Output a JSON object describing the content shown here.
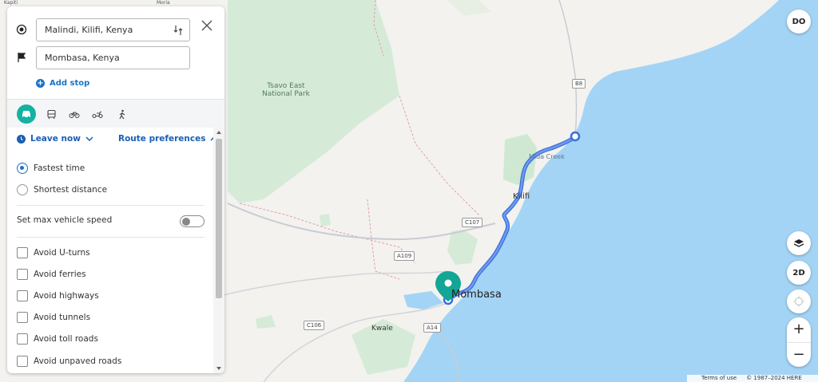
{
  "route": {
    "origin": "Malindi, Kilifi, Kenya",
    "destination": "Mombasa, Kenya",
    "add_stop": "Add stop"
  },
  "modes": [
    {
      "name": "car",
      "active": true
    },
    {
      "name": "public-transport",
      "active": false
    },
    {
      "name": "bicycle",
      "active": false
    },
    {
      "name": "scooter",
      "active": false
    },
    {
      "name": "pedestrian",
      "active": false
    }
  ],
  "options": {
    "leave_now": "Leave now",
    "route_preferences": "Route preferences",
    "fastest_time": "Fastest time",
    "shortest_distance": "Shortest distance",
    "selected": "fastest",
    "max_speed_label": "Set max vehicle speed",
    "max_speed_enabled": false,
    "avoid": [
      "Avoid U-turns",
      "Avoid ferries",
      "Avoid highways",
      "Avoid tunnels",
      "Avoid toll roads",
      "Avoid unpaved roads"
    ]
  },
  "map": {
    "labels": {
      "tsavo": "Tsavo East\nNational Park",
      "watamu": "Mida Creek",
      "kilifi": "Kilifi",
      "mombasa": "Mombasa",
      "kwale": "Kwale",
      "a109": "A109",
      "c107": "C107",
      "c106": "C106",
      "a14": "A14",
      "b8": "B8",
      "top1": "Kapiti",
      "top2": "Moria"
    },
    "controls": {
      "user_initials": "DO",
      "view_mode": "2D",
      "zoom_in": "+",
      "zoom_out": "−"
    },
    "footer": {
      "terms": "Terms of use",
      "copyright": "© 1987–2024 HERE"
    },
    "colors": {
      "water": "#a3d4f5",
      "land": "#f3f2ef",
      "park": "#cfe8d2",
      "route": "#4a7fe0",
      "marker": "#13a595"
    }
  }
}
